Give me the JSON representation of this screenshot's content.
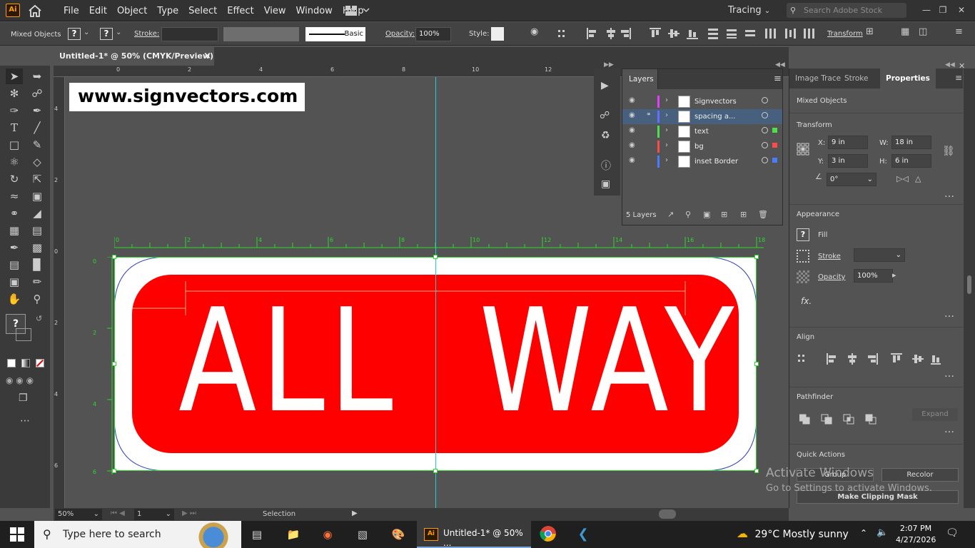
{
  "app": {
    "logo": "Ai",
    "menu": [
      "File",
      "Edit",
      "Object",
      "Type",
      "Select",
      "Effect",
      "View",
      "Window",
      "Help"
    ],
    "workspace": "Tracing",
    "search_placeholder": "Search Adobe Stock"
  },
  "control": {
    "selection": "Mixed Objects",
    "stroke_label": "Stroke:",
    "brush": "Basic",
    "opacity_label": "Opacity:",
    "opacity": "100%",
    "style_label": "Style:",
    "transform": "Transform"
  },
  "doc": {
    "tab_title": "Untitled-1* @ 50% (CMYK/Preview)",
    "close": "×"
  },
  "canvas": {
    "website": "www.signvectors.com",
    "sign_text": "ALL  WAY",
    "ruler_top": [
      "0",
      "2",
      "4",
      "6",
      "8",
      "10",
      "12"
    ],
    "ruler_art": [
      "0",
      "2",
      "4",
      "6",
      "8",
      "10",
      "12",
      "14",
      "16",
      "18"
    ],
    "ruler_left": [
      "4",
      "2",
      "0",
      "2",
      "4",
      "6"
    ],
    "art_left": [
      "0",
      "2",
      "4",
      "6"
    ],
    "sign_color": "#ff0000"
  },
  "layers": {
    "title": "Layers",
    "rows": [
      {
        "name": "Signvectors",
        "color": "#e040fb",
        "locked": false,
        "sel": false,
        "sq": ""
      },
      {
        "name": "spacing a...",
        "color": "#6a6cff",
        "locked": true,
        "sel": true,
        "sq": ""
      },
      {
        "name": "text",
        "color": "#4ce04c",
        "locked": false,
        "sel": false,
        "sq": "#4ce04c"
      },
      {
        "name": "bg",
        "color": "#ff4a4a",
        "locked": false,
        "sel": false,
        "sq": "#ff4a4a"
      },
      {
        "name": "inset Border",
        "color": "#4a7cff",
        "locked": false,
        "sel": false,
        "sq": "#4a7cff"
      }
    ],
    "count": "5 Layers"
  },
  "props": {
    "tabs": [
      "Image Trace",
      "Stroke",
      "Properties"
    ],
    "selection": "Mixed Objects",
    "transform_title": "Transform",
    "x_label": "X:",
    "x": "9 in",
    "w_label": "W:",
    "w": "18 in",
    "y_label": "Y:",
    "y": "3 in",
    "h_label": "H:",
    "h": "6 in",
    "angle": "0°",
    "appearance_title": "Appearance",
    "fill": "Fill",
    "stroke": "Stroke",
    "opacity_label": "Opacity",
    "opacity": "100%",
    "fx": "fx.",
    "align_title": "Align",
    "pathfinder_title": "Pathfinder",
    "expand": "Expand",
    "quick_title": "Quick Actions",
    "group": "Group",
    "recolor": "Recolor",
    "clip": "Make Clipping Mask"
  },
  "watermark": {
    "line1": "Activate Windows",
    "line2": "Go to Settings to activate Windows."
  },
  "status": {
    "zoom": "50%",
    "artboard": "1",
    "tool": "Selection"
  },
  "taskbar": {
    "search": "Type here to search",
    "app_title": "Untitled-1* @ 50% ...",
    "weather": "29°C  Mostly sunny",
    "time": "2:07 PM",
    "date": "4/27/2026"
  }
}
